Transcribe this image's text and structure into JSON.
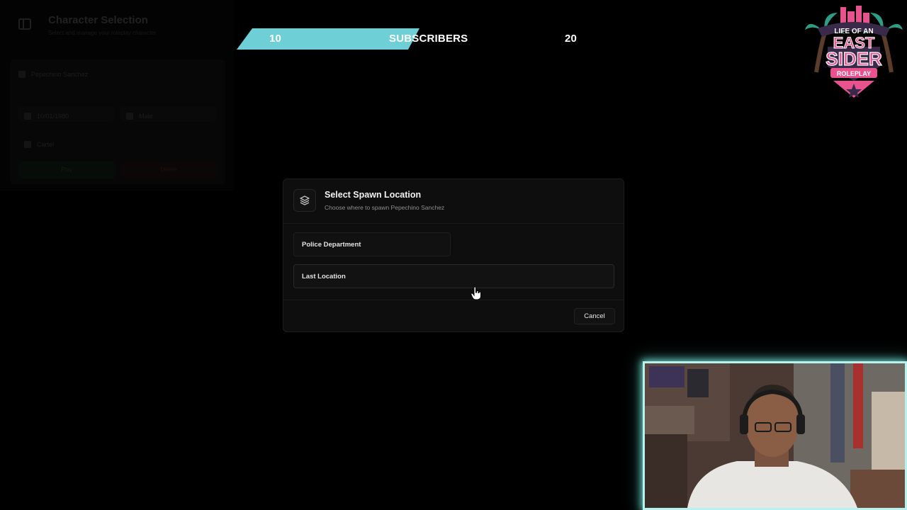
{
  "background_panel": {
    "title": "Character Selection",
    "subtitle": "Select and manage your roleplay character",
    "character": {
      "name": "Pepechino Sanchez",
      "dob": "10/01/1980",
      "gender": "Male",
      "job": "Cartel"
    },
    "play_label": "Play",
    "delete_label": "Delete"
  },
  "goal_bar": {
    "start": "10",
    "label": "SUBSCRIBERS",
    "end": "20",
    "progress": 0.53,
    "color": "#6fcfd6"
  },
  "logo": {
    "line1": "LIFE OF AN",
    "line2": "EAST",
    "line3": "SIDER",
    "line4": "ROLEPLAY"
  },
  "modal": {
    "icon": "layers-icon",
    "title": "Select Spawn Location",
    "subtitle": "Choose where to spawn Pepechino Sanchez",
    "locations": [
      {
        "label": "Police Department"
      },
      {
        "label": "Last Location"
      }
    ],
    "cancel_label": "Cancel"
  },
  "colors": {
    "modal_bg": "#0e0e0e",
    "webcam_border": "#b9f1ee"
  }
}
